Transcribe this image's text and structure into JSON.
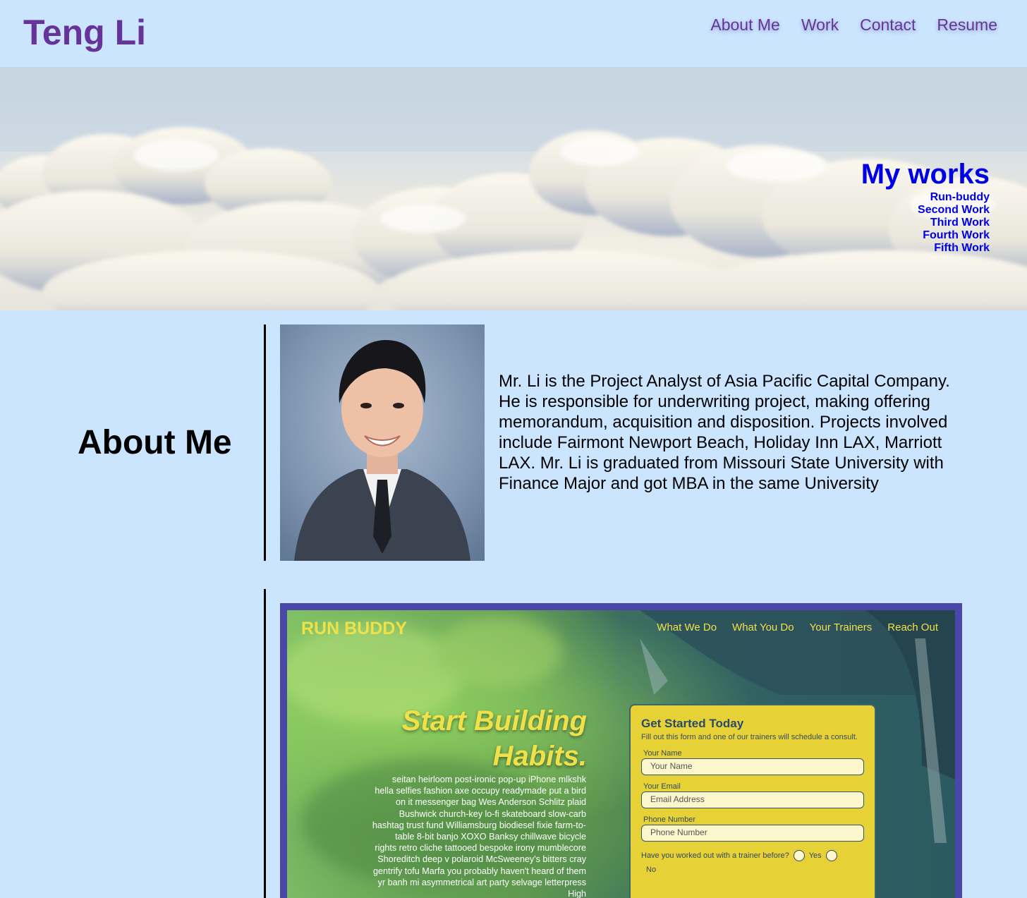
{
  "header": {
    "brand": "Teng Li",
    "nav": [
      "About Me",
      "Work",
      "Contact",
      "Resume"
    ]
  },
  "hero": {
    "works_title": "My works",
    "works": [
      "Run-buddy",
      "Second Work",
      "Third Work",
      "Fourth Work",
      "Fifth Work"
    ]
  },
  "about": {
    "heading": "About Me",
    "bio": "Mr. Li is the Project Analyst of Asia Pacific Capital Company. He is responsible for underwriting project, making offering memorandum, acquisition and disposition. Projects involved include Fairmont Newport Beach, Holiday Inn LAX, Marriott LAX. Mr. Li is graduated from Missouri State University with Finance Major and got MBA in the same University"
  },
  "project": {
    "logo": "RUN BUDDY",
    "nav": [
      "What We Do",
      "What You Do",
      "Your Trainers",
      "Reach Out"
    ],
    "headline_1": "Start Building",
    "headline_2": "Habits.",
    "text": "seitan heirloom post-ironic pop-up iPhone mlkshk hella selfies fashion axe occupy readymade put a bird on it messenger bag Wes Anderson Schlitz plaid Bushwick church-key lo-fi skateboard slow-carb hashtag trust fund Williamsburg biodiesel fixie farm-to-table 8-bit banjo XOXO Banksy chillwave bicycle rights retro cliche tattooed bespoke irony mumblecore Shoreditch deep v polaroid McSweeney's bitters cray gentrify tofu Marfa you probably haven't heard of them yr banh mi asymmetrical art party selvage letterpress High",
    "form": {
      "title": "Get Started Today",
      "subtitle": "Fill out this form and one of our trainers will schedule a consult.",
      "name_label": "Your Name",
      "name_placeholder": "Your Name",
      "email_label": "Your Email",
      "email_placeholder": "Email Address",
      "phone_label": "Phone Number",
      "phone_placeholder": "Phone Number",
      "question": "Have you worked out with a trainer before?",
      "yes": "Yes",
      "no": "No"
    }
  },
  "colors": {
    "background": "#cce5ff",
    "brand": "#663399",
    "works_link": "#0000e6",
    "project_frame": "#4a47a8",
    "runbuddy_yellow": "#f0e04a"
  }
}
